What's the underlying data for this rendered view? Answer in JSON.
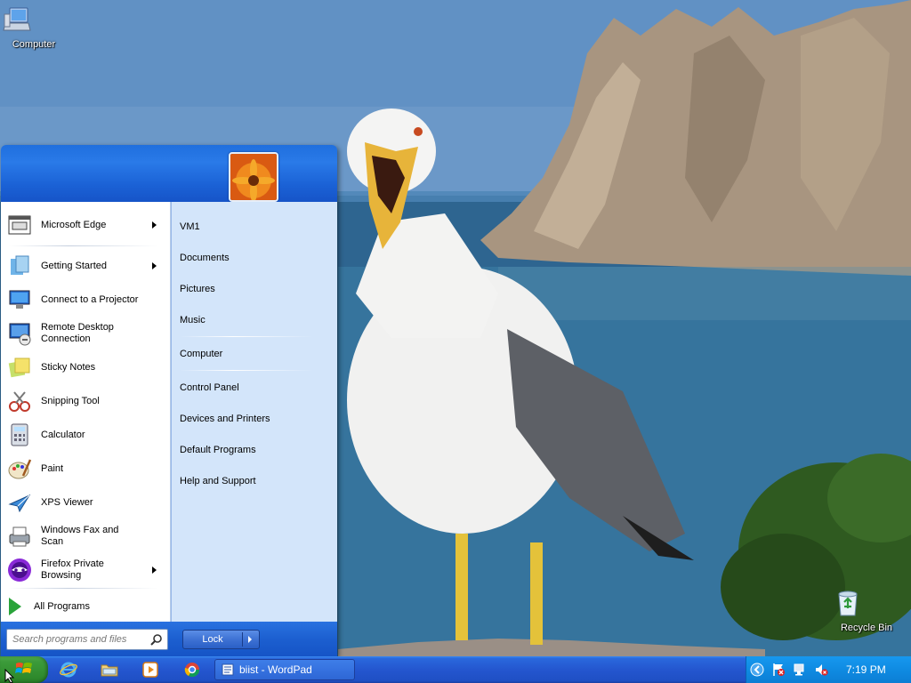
{
  "desktop": {
    "icons": [
      {
        "label": "Computer",
        "icon": "computer-icon"
      },
      {
        "label": "Recycle Bin",
        "icon": "recycle-bin-icon"
      }
    ]
  },
  "start_menu": {
    "pinned": [
      {
        "label": "Microsoft Edge",
        "icon": "edge-icon",
        "has_submenu": true
      },
      {
        "label": "Getting Started",
        "icon": "getting-started-icon",
        "has_submenu": true
      },
      {
        "label": "Connect to a Projector",
        "icon": "projector-icon",
        "has_submenu": false
      },
      {
        "label": "Remote Desktop Connection",
        "icon": "remote-desktop-icon",
        "has_submenu": false
      },
      {
        "label": "Sticky Notes",
        "icon": "sticky-notes-icon",
        "has_submenu": false
      },
      {
        "label": "Snipping Tool",
        "icon": "snipping-tool-icon",
        "has_submenu": false
      },
      {
        "label": "Calculator",
        "icon": "calculator-icon",
        "has_submenu": false
      },
      {
        "label": "Paint",
        "icon": "paint-icon",
        "has_submenu": false
      },
      {
        "label": "XPS Viewer",
        "icon": "xps-viewer-icon",
        "has_submenu": false
      },
      {
        "label": "Windows Fax and Scan",
        "icon": "fax-scan-icon",
        "has_submenu": false
      },
      {
        "label": "Firefox Private Browsing",
        "icon": "firefox-private-icon",
        "has_submenu": true
      }
    ],
    "all_programs": "All Programs",
    "places": [
      {
        "label": "VM1"
      },
      {
        "label": "Documents"
      },
      {
        "label": "Pictures"
      },
      {
        "label": "Music"
      },
      {
        "label": "Computer"
      },
      {
        "label": "Control Panel"
      },
      {
        "label": "Devices and Printers"
      },
      {
        "label": "Default Programs"
      },
      {
        "label": "Help and Support"
      }
    ],
    "search_placeholder": "Search programs and files",
    "lock_label": "Lock"
  },
  "taskbar": {
    "quick_launch": [
      "internet-explorer-icon",
      "file-explorer-icon",
      "media-player-icon",
      "chrome-icon"
    ],
    "open_window": "biist - WordPad",
    "clock": "7:19 PM"
  },
  "colors": {
    "taskbar_blue": "#2456cf",
    "start_green": "#3c9b3a",
    "tray_blue": "#0f8be2",
    "places_panel": "#d3e5fa"
  }
}
